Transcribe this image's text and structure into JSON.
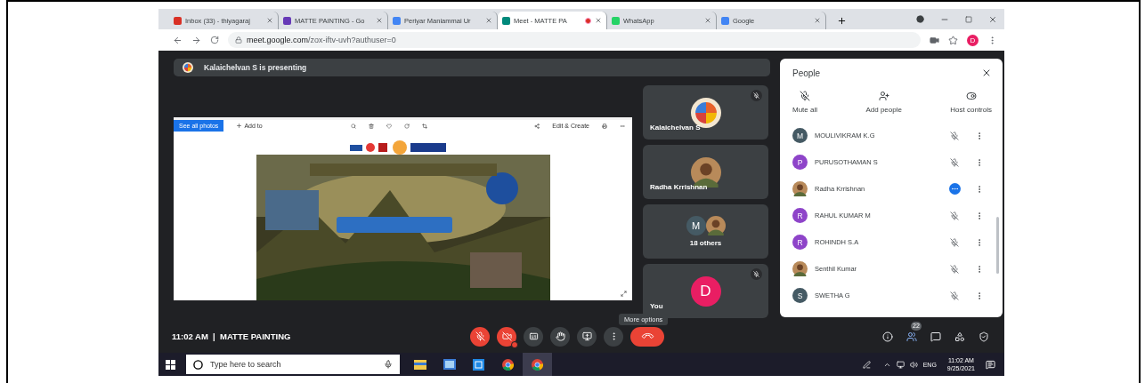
{
  "browser": {
    "tabs": [
      {
        "title": "Inbox (33) - thiyagaraj",
        "color": "#d93025",
        "selected": false,
        "recording": false
      },
      {
        "title": "MATTE PAINTING - Go",
        "color": "#673ab7",
        "selected": false,
        "recording": false
      },
      {
        "title": "Periyar Maniammai Ur",
        "color": "#4285f4",
        "selected": false,
        "recording": false
      },
      {
        "title": "Meet - MATTE PA",
        "color": "#00897b",
        "selected": true,
        "recording": true
      },
      {
        "title": "WhatsApp",
        "color": "#25d366",
        "selected": false,
        "recording": false
      },
      {
        "title": "Google",
        "color": "#4285f4",
        "selected": false,
        "recording": false
      }
    ],
    "url_host": "meet.google.com",
    "url_path": "/zox-iftv-uvh?authuser=0",
    "profile_initial": "D"
  },
  "meet": {
    "presenting_banner": "Kalaichelvan S is presenting",
    "viewer": {
      "see_all": "See all photos",
      "add_to": "Add to",
      "edit": "Edit & Create"
    },
    "tiles": [
      {
        "kind": "person",
        "name": "Kalaichelvan S",
        "avatar": {
          "kind": "logo"
        },
        "muted": true
      },
      {
        "kind": "person",
        "name": "Radha Krrishnan",
        "muted": false
      },
      {
        "kind": "group",
        "label": "18 others",
        "initial": "M"
      },
      {
        "kind": "person",
        "name": "You",
        "avatar": {
          "kind": "letter",
          "initial": "D",
          "color": "#e91e63"
        },
        "muted": true
      }
    ],
    "people": {
      "title": "People",
      "actions": [
        {
          "kind": "mute",
          "label": "Mute all"
        },
        {
          "kind": "add",
          "label": "Add people"
        },
        {
          "kind": "host",
          "label": "Host controls"
        }
      ],
      "list": [
        {
          "name": "MOULIVIKRAM K.G",
          "avatar": {
            "kind": "letter",
            "initial": "M",
            "color": "#455a64"
          },
          "muted": true
        },
        {
          "name": "PURUSOTHAMAN S",
          "avatar": {
            "kind": "letter",
            "initial": "P",
            "color": "#8e44c9"
          },
          "muted": true
        },
        {
          "name": "Radha Krrishnan",
          "muted": false
        },
        {
          "name": "RAHUL KUMAR M",
          "avatar": {
            "kind": "letter",
            "initial": "R",
            "color": "#8e44c9"
          },
          "muted": true
        },
        {
          "name": "ROHINDH S.A",
          "avatar": {
            "kind": "letter",
            "initial": "R",
            "color": "#8e44c9"
          },
          "muted": true
        },
        {
          "name": "Senthil Kumar",
          "muted": true
        },
        {
          "name": "SWETHA G",
          "avatar": {
            "kind": "letter",
            "initial": "S",
            "color": "#455a64"
          },
          "muted": true
        }
      ]
    },
    "bottom": {
      "time": "11:02 AM",
      "separator": "|",
      "meeting": "MATTE PAINTING",
      "tooltip": "More options",
      "controls": [
        {
          "kind": "mic",
          "off": true
        },
        {
          "kind": "camera",
          "off": true
        },
        {
          "kind": "captions",
          "off": false
        },
        {
          "kind": "hand",
          "off": false
        },
        {
          "kind": "present",
          "off": false
        },
        {
          "kind": "more",
          "off": false
        },
        {
          "kind": "hangup"
        }
      ],
      "people_count": "22"
    }
  },
  "taskbar": {
    "search_placeholder": "Type here to search",
    "lang": "ENG",
    "time": "11:02 AM",
    "date": "9/25/2021"
  }
}
